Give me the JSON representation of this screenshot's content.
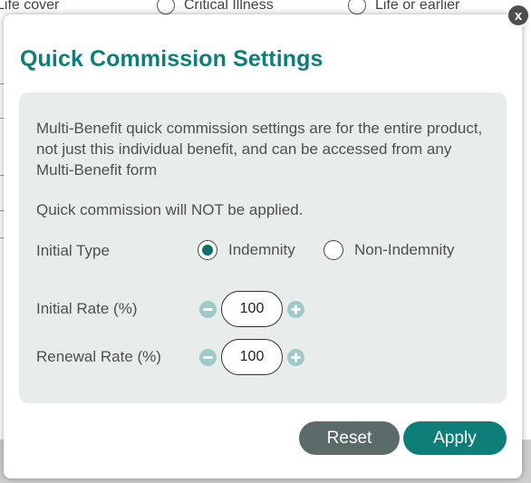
{
  "background": {
    "options": [
      {
        "label": "Life cover"
      },
      {
        "label": "Critical Illness"
      },
      {
        "label": "Life or earlier"
      }
    ]
  },
  "dialog": {
    "close_label": "x",
    "title": "Quick Commission Settings",
    "description": "Multi-Benefit quick commission settings are for the entire product, not just this individual benefit, and can be accessed from any Multi-Benefit form",
    "warning": "Quick commission will NOT be applied.",
    "initial_type": {
      "label": "Initial Type",
      "options": [
        {
          "label": "Indemnity",
          "selected": true
        },
        {
          "label": "Non-Indemnity",
          "selected": false
        }
      ]
    },
    "initial_rate": {
      "label": "Initial Rate (%)",
      "value": "100"
    },
    "renewal_rate": {
      "label": "Renewal Rate (%)",
      "value": "100"
    },
    "reset_label": "Reset",
    "apply_label": "Apply"
  },
  "colors": {
    "accent": "#0e7f78",
    "panel": "#e8edec",
    "stepper_button": "#9fc9c6",
    "reset_button": "#5a6b69",
    "close_button": "#4e4e4e"
  }
}
